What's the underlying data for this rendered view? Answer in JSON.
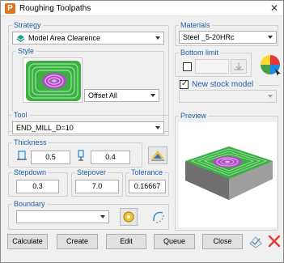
{
  "window": {
    "title": "Roughing Toolpaths",
    "app_icon_letter": "P"
  },
  "strategy": {
    "group_label": "Strategy",
    "selected": "Model Area Clearence"
  },
  "style": {
    "group_label": "Style",
    "selected": "Offset All"
  },
  "materials": {
    "group_label": "Materials",
    "selected": "Steel _5-20HRc"
  },
  "bottom_limit": {
    "group_label": "Bottom limit",
    "checked": false
  },
  "new_stock_model": {
    "label": "New stock model",
    "checked": true
  },
  "tool": {
    "group_label": "Tool",
    "selected": "END_MILL_D=10"
  },
  "thickness": {
    "group_label": "Thickness",
    "radial": "0.5",
    "axial": "0.4"
  },
  "stepdown": {
    "group_label": "Stepdown",
    "value": "0.3"
  },
  "stepover": {
    "group_label": "Stepover",
    "value": "7.0"
  },
  "tolerance": {
    "group_label": "Tolerance",
    "value": "0.16667"
  },
  "boundary": {
    "group_label": "Boundary",
    "selected": ""
  },
  "preview": {
    "group_label": "Preview"
  },
  "buttons": {
    "calculate": "Calculate",
    "create": "Create",
    "edit": "Edit",
    "queue": "Queue",
    "close": "Close"
  },
  "colors": {
    "legend": "#1f5ea8",
    "toolpath_green": "#3cb043",
    "toolpath_purple": "#b04fc4",
    "stock_grey": "#8d8d8d",
    "strategy_icon": "#20a090"
  }
}
